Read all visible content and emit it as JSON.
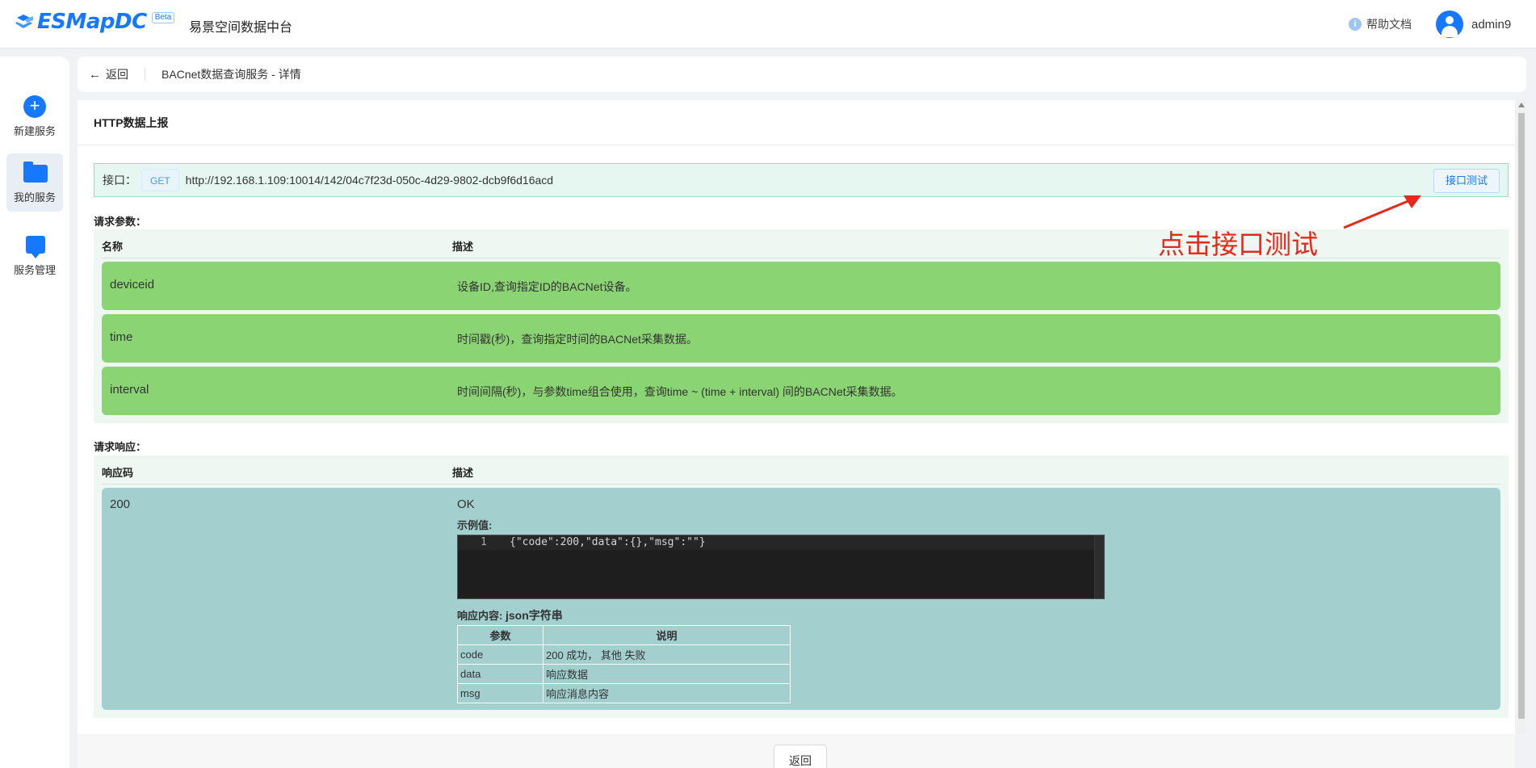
{
  "header": {
    "logo_text": "ESMapDC",
    "beta": "Beta",
    "app_name": "易景空间数据中台",
    "help": "帮助文档",
    "user": "admin9",
    "help_icon_glyph": "i"
  },
  "sidebar": {
    "items": [
      {
        "label": "新建服务",
        "icon": "plus-circle-icon"
      },
      {
        "label": "我的服务",
        "icon": "folder-icon"
      },
      {
        "label": "服务管理",
        "icon": "bookmark-icon"
      }
    ]
  },
  "breadcrumb": {
    "back": "返回",
    "title": "BACnet数据查询服务 - 详情"
  },
  "card": {
    "title": "HTTP数据上报",
    "endpoint_label": "接口：",
    "method": "GET",
    "url": "http://192.168.1.109:10014/142/04c7f23d-050c-4d29-9802-dcb9f6d16acd",
    "test_button": "接口测试"
  },
  "request": {
    "label": "请求参数：",
    "col_name": "名称",
    "col_desc": "描述",
    "params": [
      {
        "name": "deviceid",
        "desc": "设备ID,查询指定ID的BACNet设备。"
      },
      {
        "name": "time",
        "desc": "时间戳(秒)，查询指定时间的BACNet采集数据。"
      },
      {
        "name": "interval",
        "desc": "时间间隔(秒)，与参数time组合使用，查询time ~ (time + interval) 间的BACNet采集数据。"
      }
    ]
  },
  "response": {
    "label": "请求响应：",
    "col_code": "响应码",
    "col_desc": "描述",
    "code": "200",
    "status": "OK",
    "example_label": "示例值:",
    "example_line_no": "1",
    "example_code": "{\"code\":200,\"data\":{},\"msg\":\"\"}",
    "content_label": "响应内容:",
    "content_type": "json字符串",
    "spec_headers": [
      "参数",
      "说明"
    ],
    "spec_rows": [
      {
        "param": "code",
        "desc": "200 成功， 其他 失败"
      },
      {
        "param": "data",
        "desc": "响应数据"
      },
      {
        "param": "msg",
        "desc": "响应消息内容"
      }
    ]
  },
  "footer": {
    "back_button": "返回"
  },
  "annotation": {
    "text": "点击接口测试",
    "color": "#e8281b"
  },
  "colors": {
    "primary": "#1677ff",
    "param_row": "#8bd474",
    "response_row": "#a3cfcf"
  }
}
